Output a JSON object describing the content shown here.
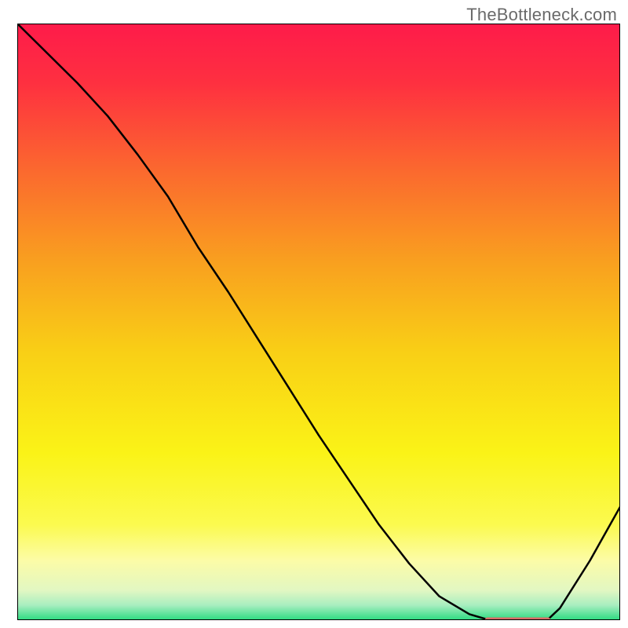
{
  "watermark": "TheBottleneck.com",
  "chart_data": {
    "type": "line",
    "title": "",
    "xlabel": "",
    "ylabel": "",
    "xlim": [
      0,
      100
    ],
    "ylim": [
      0,
      100
    ],
    "series": [
      {
        "name": "bottleneck-curve",
        "color": "#000000",
        "stroke_width": 2.5,
        "x": [
          0,
          5,
          10,
          15,
          20,
          25,
          30,
          35,
          40,
          45,
          50,
          55,
          60,
          65,
          70,
          75,
          78,
          80,
          82,
          85,
          88,
          90,
          95,
          100
        ],
        "y": [
          100,
          95,
          90,
          84.5,
          78,
          71,
          62.5,
          55,
          47,
          39,
          31,
          23.5,
          16,
          9.5,
          4,
          1,
          0.1,
          0,
          0,
          0,
          0.1,
          2,
          10,
          19
        ]
      },
      {
        "name": "optimal-flat-marker",
        "color": "#d96a66",
        "stroke_width": 7,
        "x": [
          78,
          88
        ],
        "y": [
          0,
          0
        ]
      }
    ],
    "background_gradient": {
      "stops": [
        {
          "offset": 0.0,
          "color": "#fe1b4a"
        },
        {
          "offset": 0.1,
          "color": "#fe3040"
        },
        {
          "offset": 0.25,
          "color": "#fb6a2e"
        },
        {
          "offset": 0.4,
          "color": "#f9a01f"
        },
        {
          "offset": 0.55,
          "color": "#f9cf16"
        },
        {
          "offset": 0.72,
          "color": "#faf317"
        },
        {
          "offset": 0.84,
          "color": "#fbfa4f"
        },
        {
          "offset": 0.9,
          "color": "#fcfca7"
        },
        {
          "offset": 0.95,
          "color": "#e2f7c2"
        },
        {
          "offset": 0.975,
          "color": "#a8eec0"
        },
        {
          "offset": 1.0,
          "color": "#2bdb80"
        }
      ]
    },
    "frame_color": "#000000"
  }
}
